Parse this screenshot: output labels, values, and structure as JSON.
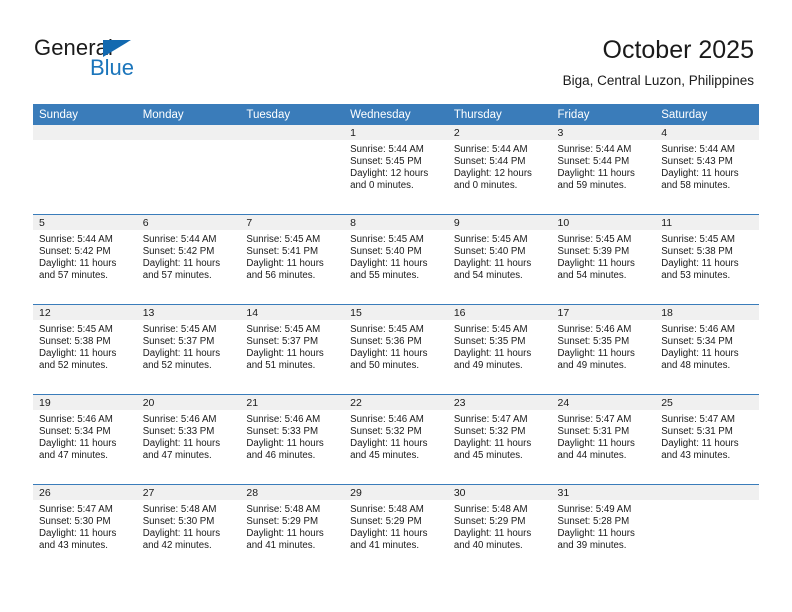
{
  "brand": {
    "name_top": "General",
    "name_bottom": "Blue",
    "triangle_color": "#1269b0",
    "blue_color": "#1b75bb"
  },
  "header": {
    "title": "October 2025",
    "subtitle": "Biga, Central Luzon, Philippines"
  },
  "theme": {
    "header_bg": "#3a7cba",
    "daynum_bg": "#f0f0f0",
    "grid_line": "#3a7cba",
    "text": "#1a1a1a"
  },
  "weekday_headers": [
    "Sunday",
    "Monday",
    "Tuesday",
    "Wednesday",
    "Thursday",
    "Friday",
    "Saturday"
  ],
  "weeks": [
    [
      {
        "day": "",
        "sunrise": "",
        "sunset": "",
        "daylight_line1": "",
        "daylight_line2": ""
      },
      {
        "day": "",
        "sunrise": "",
        "sunset": "",
        "daylight_line1": "",
        "daylight_line2": ""
      },
      {
        "day": "",
        "sunrise": "",
        "sunset": "",
        "daylight_line1": "",
        "daylight_line2": ""
      },
      {
        "day": "1",
        "sunrise": "Sunrise: 5:44 AM",
        "sunset": "Sunset: 5:45 PM",
        "daylight_line1": "Daylight: 12 hours",
        "daylight_line2": "and 0 minutes."
      },
      {
        "day": "2",
        "sunrise": "Sunrise: 5:44 AM",
        "sunset": "Sunset: 5:44 PM",
        "daylight_line1": "Daylight: 12 hours",
        "daylight_line2": "and 0 minutes."
      },
      {
        "day": "3",
        "sunrise": "Sunrise: 5:44 AM",
        "sunset": "Sunset: 5:44 PM",
        "daylight_line1": "Daylight: 11 hours",
        "daylight_line2": "and 59 minutes."
      },
      {
        "day": "4",
        "sunrise": "Sunrise: 5:44 AM",
        "sunset": "Sunset: 5:43 PM",
        "daylight_line1": "Daylight: 11 hours",
        "daylight_line2": "and 58 minutes."
      }
    ],
    [
      {
        "day": "5",
        "sunrise": "Sunrise: 5:44 AM",
        "sunset": "Sunset: 5:42 PM",
        "daylight_line1": "Daylight: 11 hours",
        "daylight_line2": "and 57 minutes."
      },
      {
        "day": "6",
        "sunrise": "Sunrise: 5:44 AM",
        "sunset": "Sunset: 5:42 PM",
        "daylight_line1": "Daylight: 11 hours",
        "daylight_line2": "and 57 minutes."
      },
      {
        "day": "7",
        "sunrise": "Sunrise: 5:45 AM",
        "sunset": "Sunset: 5:41 PM",
        "daylight_line1": "Daylight: 11 hours",
        "daylight_line2": "and 56 minutes."
      },
      {
        "day": "8",
        "sunrise": "Sunrise: 5:45 AM",
        "sunset": "Sunset: 5:40 PM",
        "daylight_line1": "Daylight: 11 hours",
        "daylight_line2": "and 55 minutes."
      },
      {
        "day": "9",
        "sunrise": "Sunrise: 5:45 AM",
        "sunset": "Sunset: 5:40 PM",
        "daylight_line1": "Daylight: 11 hours",
        "daylight_line2": "and 54 minutes."
      },
      {
        "day": "10",
        "sunrise": "Sunrise: 5:45 AM",
        "sunset": "Sunset: 5:39 PM",
        "daylight_line1": "Daylight: 11 hours",
        "daylight_line2": "and 54 minutes."
      },
      {
        "day": "11",
        "sunrise": "Sunrise: 5:45 AM",
        "sunset": "Sunset: 5:38 PM",
        "daylight_line1": "Daylight: 11 hours",
        "daylight_line2": "and 53 minutes."
      }
    ],
    [
      {
        "day": "12",
        "sunrise": "Sunrise: 5:45 AM",
        "sunset": "Sunset: 5:38 PM",
        "daylight_line1": "Daylight: 11 hours",
        "daylight_line2": "and 52 minutes."
      },
      {
        "day": "13",
        "sunrise": "Sunrise: 5:45 AM",
        "sunset": "Sunset: 5:37 PM",
        "daylight_line1": "Daylight: 11 hours",
        "daylight_line2": "and 52 minutes."
      },
      {
        "day": "14",
        "sunrise": "Sunrise: 5:45 AM",
        "sunset": "Sunset: 5:37 PM",
        "daylight_line1": "Daylight: 11 hours",
        "daylight_line2": "and 51 minutes."
      },
      {
        "day": "15",
        "sunrise": "Sunrise: 5:45 AM",
        "sunset": "Sunset: 5:36 PM",
        "daylight_line1": "Daylight: 11 hours",
        "daylight_line2": "and 50 minutes."
      },
      {
        "day": "16",
        "sunrise": "Sunrise: 5:45 AM",
        "sunset": "Sunset: 5:35 PM",
        "daylight_line1": "Daylight: 11 hours",
        "daylight_line2": "and 49 minutes."
      },
      {
        "day": "17",
        "sunrise": "Sunrise: 5:46 AM",
        "sunset": "Sunset: 5:35 PM",
        "daylight_line1": "Daylight: 11 hours",
        "daylight_line2": "and 49 minutes."
      },
      {
        "day": "18",
        "sunrise": "Sunrise: 5:46 AM",
        "sunset": "Sunset: 5:34 PM",
        "daylight_line1": "Daylight: 11 hours",
        "daylight_line2": "and 48 minutes."
      }
    ],
    [
      {
        "day": "19",
        "sunrise": "Sunrise: 5:46 AM",
        "sunset": "Sunset: 5:34 PM",
        "daylight_line1": "Daylight: 11 hours",
        "daylight_line2": "and 47 minutes."
      },
      {
        "day": "20",
        "sunrise": "Sunrise: 5:46 AM",
        "sunset": "Sunset: 5:33 PM",
        "daylight_line1": "Daylight: 11 hours",
        "daylight_line2": "and 47 minutes."
      },
      {
        "day": "21",
        "sunrise": "Sunrise: 5:46 AM",
        "sunset": "Sunset: 5:33 PM",
        "daylight_line1": "Daylight: 11 hours",
        "daylight_line2": "and 46 minutes."
      },
      {
        "day": "22",
        "sunrise": "Sunrise: 5:46 AM",
        "sunset": "Sunset: 5:32 PM",
        "daylight_line1": "Daylight: 11 hours",
        "daylight_line2": "and 45 minutes."
      },
      {
        "day": "23",
        "sunrise": "Sunrise: 5:47 AM",
        "sunset": "Sunset: 5:32 PM",
        "daylight_line1": "Daylight: 11 hours",
        "daylight_line2": "and 45 minutes."
      },
      {
        "day": "24",
        "sunrise": "Sunrise: 5:47 AM",
        "sunset": "Sunset: 5:31 PM",
        "daylight_line1": "Daylight: 11 hours",
        "daylight_line2": "and 44 minutes."
      },
      {
        "day": "25",
        "sunrise": "Sunrise: 5:47 AM",
        "sunset": "Sunset: 5:31 PM",
        "daylight_line1": "Daylight: 11 hours",
        "daylight_line2": "and 43 minutes."
      }
    ],
    [
      {
        "day": "26",
        "sunrise": "Sunrise: 5:47 AM",
        "sunset": "Sunset: 5:30 PM",
        "daylight_line1": "Daylight: 11 hours",
        "daylight_line2": "and 43 minutes."
      },
      {
        "day": "27",
        "sunrise": "Sunrise: 5:48 AM",
        "sunset": "Sunset: 5:30 PM",
        "daylight_line1": "Daylight: 11 hours",
        "daylight_line2": "and 42 minutes."
      },
      {
        "day": "28",
        "sunrise": "Sunrise: 5:48 AM",
        "sunset": "Sunset: 5:29 PM",
        "daylight_line1": "Daylight: 11 hours",
        "daylight_line2": "and 41 minutes."
      },
      {
        "day": "29",
        "sunrise": "Sunrise: 5:48 AM",
        "sunset": "Sunset: 5:29 PM",
        "daylight_line1": "Daylight: 11 hours",
        "daylight_line2": "and 41 minutes."
      },
      {
        "day": "30",
        "sunrise": "Sunrise: 5:48 AM",
        "sunset": "Sunset: 5:29 PM",
        "daylight_line1": "Daylight: 11 hours",
        "daylight_line2": "and 40 minutes."
      },
      {
        "day": "31",
        "sunrise": "Sunrise: 5:49 AM",
        "sunset": "Sunset: 5:28 PM",
        "daylight_line1": "Daylight: 11 hours",
        "daylight_line2": "and 39 minutes."
      },
      {
        "day": "",
        "sunrise": "",
        "sunset": "",
        "daylight_line1": "",
        "daylight_line2": ""
      }
    ]
  ]
}
